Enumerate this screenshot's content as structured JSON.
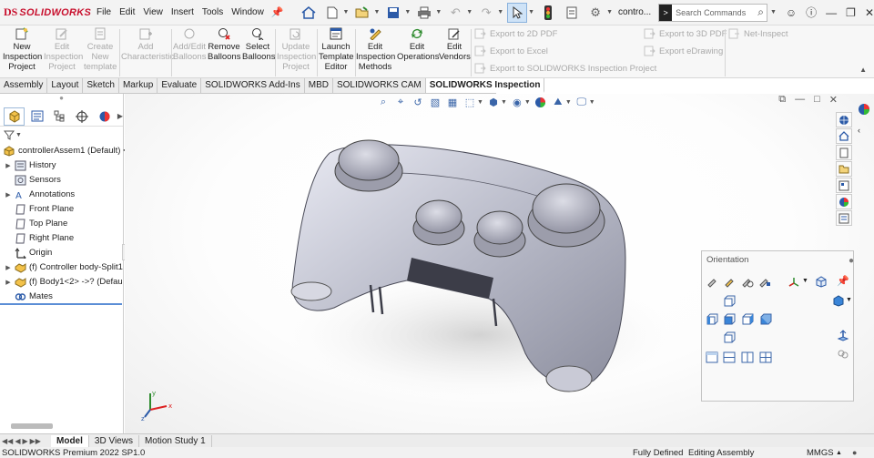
{
  "app": {
    "brand_ds": "DS",
    "brand_name": "SOLIDWORKS",
    "document_name": "contro...",
    "menu": [
      "File",
      "Edit",
      "View",
      "Insert",
      "Tools",
      "Window"
    ]
  },
  "search": {
    "placeholder": "Search Commands",
    "icon_text": ">"
  },
  "ribbon": {
    "buttons": [
      {
        "label": "New\nInspection\nProject",
        "enabled": true
      },
      {
        "label": "Edit\nInspection\nProject",
        "enabled": false
      },
      {
        "label": "Create\nNew\ntemplate",
        "enabled": false
      },
      {
        "label": "Add\nCharacteristic",
        "enabled": false
      },
      {
        "label": "Add/Edit\nBalloons",
        "enabled": false
      },
      {
        "label": "Remove\nBalloons",
        "enabled": true
      },
      {
        "label": "Select\nBalloons",
        "enabled": true
      },
      {
        "label": "Update\nInspection\nProject",
        "enabled": false
      },
      {
        "label": "Launch\nTemplate\nEditor",
        "enabled": true
      },
      {
        "label": "Edit\nInspection\nMethods",
        "enabled": true
      },
      {
        "label": "Edit\nOperations",
        "enabled": true
      },
      {
        "label": "Edit\nVendors",
        "enabled": true
      }
    ],
    "exports": [
      "Export to 2D PDF",
      "Export to Excel",
      "Export to SOLIDWORKS Inspection Project",
      "Export to 3D PDF",
      "Export eDrawing",
      "Net-Inspect"
    ]
  },
  "tabs": [
    "Assembly",
    "Layout",
    "Sketch",
    "Markup",
    "Evaluate",
    "SOLIDWORKS Add-Ins",
    "MBD",
    "SOLIDWORKS CAM",
    "SOLIDWORKS Inspection"
  ],
  "active_tab": "SOLIDWORKS Inspection",
  "tree": {
    "root": "controllerAssem1 (Default) <",
    "items": [
      {
        "label": "History",
        "expandable": true
      },
      {
        "label": "Sensors",
        "expandable": false
      },
      {
        "label": "Annotations",
        "expandable": true
      },
      {
        "label": "Front Plane",
        "expandable": false
      },
      {
        "label": "Top Plane",
        "expandable": false
      },
      {
        "label": "Right Plane",
        "expandable": false
      },
      {
        "label": "Origin",
        "expandable": false
      },
      {
        "label": "(f) Controller body-Split1",
        "expandable": true
      },
      {
        "label": "(f) Body1<2> ->? (Defau",
        "expandable": true
      },
      {
        "label": "Mates",
        "expandable": false
      }
    ]
  },
  "orientation": {
    "title": "Orientation"
  },
  "triad": {
    "x": "x",
    "y": "y",
    "z": "z"
  },
  "bottom_tabs": [
    "Model",
    "3D Views",
    "Motion Study 1"
  ],
  "active_bottom_tab": "Model",
  "status": {
    "version": "SOLIDWORKS Premium 2022 SP1.0",
    "state": "Fully Defined",
    "mode": "Editing Assembly",
    "units": "MMGS"
  },
  "colors": {
    "accent": "#2b5aa8",
    "brand": "#c8102e",
    "selection": "#cfe3f7"
  }
}
